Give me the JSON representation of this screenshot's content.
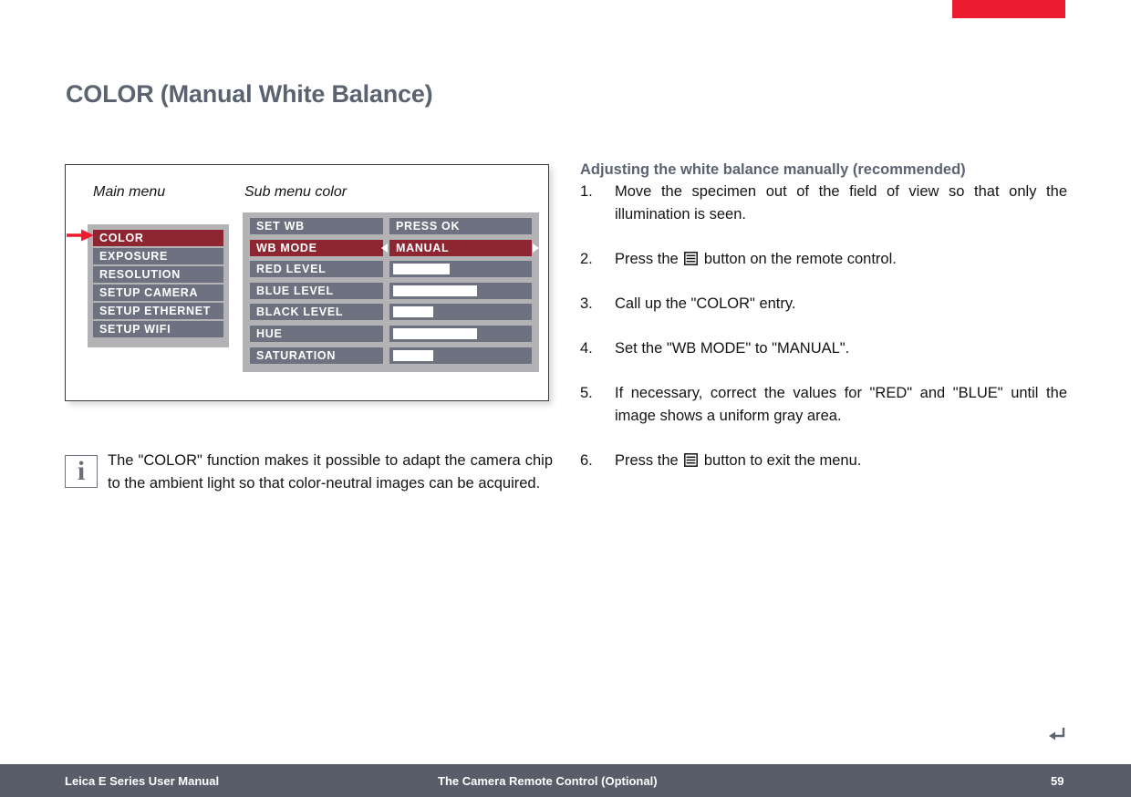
{
  "page": {
    "title": "COLOR (Manual White Balance)",
    "accent_red": "#ed1b2f",
    "menu_red": "#8d2631",
    "menu_gray": "#6e7180",
    "heading_color": "#5c6370"
  },
  "figure": {
    "caption_main": "Main menu",
    "caption_sub": "Sub menu color",
    "pointer_icon": "red-arrow-right-icon",
    "main_menu": {
      "items": [
        {
          "label": "COLOR",
          "selected": true
        },
        {
          "label": "EXPOSURE",
          "selected": false
        },
        {
          "label": "RESOLUTION",
          "selected": false
        },
        {
          "label": "SETUP CAMERA",
          "selected": false
        },
        {
          "label": "SETUP ETHERNET",
          "selected": false
        },
        {
          "label": "SETUP WIFI",
          "selected": false
        }
      ]
    },
    "sub_menu": {
      "items": [
        {
          "label": "SET WB",
          "value": "PRESS OK",
          "type": "text",
          "selected": false,
          "fill": 0
        },
        {
          "label": "WB MODE",
          "value": "MANUAL",
          "type": "text",
          "selected": true,
          "fill": 0,
          "arrows": true
        },
        {
          "label": "RED LEVEL",
          "value": "",
          "type": "slider",
          "selected": false,
          "fill": 42
        },
        {
          "label": "BLUE LEVEL",
          "value": "",
          "type": "slider",
          "selected": false,
          "fill": 62
        },
        {
          "label": "BLACK LEVEL",
          "value": "",
          "type": "slider",
          "selected": false,
          "fill": 30
        },
        {
          "label": "HUE",
          "value": "",
          "type": "slider",
          "selected": false,
          "fill": 62
        },
        {
          "label": "SATURATION",
          "value": "",
          "type": "slider",
          "selected": false,
          "fill": 30
        }
      ]
    }
  },
  "note": {
    "icon": "info-icon",
    "icon_glyph": "i",
    "text": "The \"COLOR\" function makes it possible to adapt the camera chip to the ambient light so that color-neutral images can be acquired."
  },
  "instructions": {
    "heading": "Adjusting the white balance manually (recommended)",
    "steps": [
      {
        "num": "1.",
        "text_before": "Move the specimen out of the field of view so that only the illumination is seen.",
        "icon": null,
        "text_after": ""
      },
      {
        "num": "2.",
        "text_before": "Press the ",
        "icon": "menu-button-icon",
        "text_after": " button on the remote control."
      },
      {
        "num": "3.",
        "text_before": "Call up the \"COLOR\" entry.",
        "icon": null,
        "text_after": ""
      },
      {
        "num": "4.",
        "text_before": "Set the \"WB MODE\" to \"MANUAL\".",
        "icon": null,
        "text_after": ""
      },
      {
        "num": "5.",
        "text_before": "If necessary, correct the values for \"RED\" and \"BLUE\" until the image shows a uniform gray area.",
        "icon": null,
        "text_after": ""
      },
      {
        "num": "6.",
        "text_before": "Press the ",
        "icon": "menu-button-icon",
        "text_after": " button to exit the menu."
      }
    ]
  },
  "return_symbol": {
    "icon": "return-arrow-icon"
  },
  "footer": {
    "left": "Leica E Series User Manual",
    "center": "The Camera Remote Control (Optional)",
    "page": "59"
  }
}
